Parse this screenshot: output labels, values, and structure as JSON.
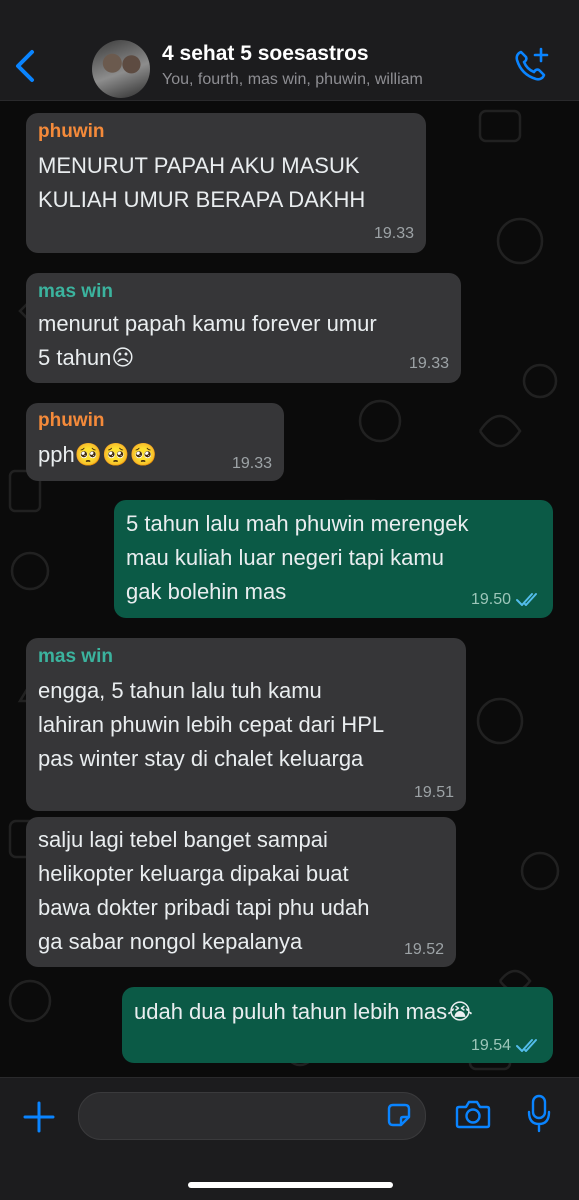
{
  "header": {
    "title": "4 sehat 5 soesastros",
    "subtitle": "You, fourth, mas win, phuwin, william"
  },
  "messages": [
    {
      "sender": "phuwin",
      "lines": [
        "MENURUT PAPAH AKU MASUK",
        "KULIAH UMUR BERAPA DAKHH"
      ],
      "time": "19.33"
    },
    {
      "sender": "mas win",
      "lines": [
        "menurut papah kamu forever umur",
        "5 tahun☹"
      ],
      "time": "19.33"
    },
    {
      "sender": "phuwin",
      "lines": [
        "pph🥺🥺🥺"
      ],
      "time": "19.33"
    },
    {
      "lines": [
        "5 tahun lalu mah phuwin merengek",
        "mau kuliah luar negeri tapi kamu",
        "gak bolehin mas"
      ],
      "time": "19.50"
    },
    {
      "sender": "mas win",
      "lines": [
        "engga, 5 tahun lalu tuh kamu",
        "lahiran phuwin lebih cepat dari HPL",
        "pas winter stay di chalet keluarga"
      ],
      "time": "19.51"
    },
    {
      "lines": [
        "salju lagi tebel banget sampai",
        "helikopter keluarga dipakai buat",
        "bawa dokter pribadi tapi phu udah",
        "ga sabar nongol kepalanya"
      ],
      "time": "19.52"
    },
    {
      "lines": [
        "udah dua puluh tahun lebih mas😭"
      ],
      "time": "19.54"
    }
  ],
  "colors": {
    "accent": "#0a84ff",
    "outgoing_bubble": "#0b5a46",
    "incoming_bubble": "#363638",
    "sender_phuwin": "#f48a3a",
    "sender_mas_win": "#3bb39e"
  },
  "icons": {
    "back": "chevron-left-icon",
    "call": "phone-plus-icon",
    "attach": "plus-icon",
    "sticker": "sticker-icon",
    "camera": "camera-icon",
    "mic": "microphone-icon"
  }
}
